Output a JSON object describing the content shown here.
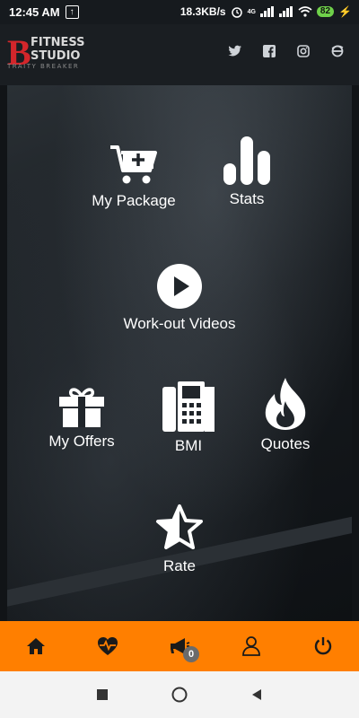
{
  "status_bar": {
    "time": "12:45 AM",
    "net_speed": "18.3KB/s",
    "battery": "82",
    "network": "4G"
  },
  "brand": {
    "logo_letter": "B",
    "line1": "FITNESS",
    "line2": "STUDIO",
    "tagline": "TRAITY BREAKER"
  },
  "social": [
    "twitter-icon",
    "facebook-icon",
    "instagram-icon",
    "web-icon"
  ],
  "menu": {
    "my_package": "My Package",
    "stats": "Stats",
    "workout_videos": "Work-out Videos",
    "my_offers": "My Offers",
    "bmi": "BMI",
    "quotes": "Quotes",
    "rate": "Rate"
  },
  "bottom_nav": {
    "notification_count": "0"
  },
  "colors": {
    "accent": "#ff7f00",
    "brand_red": "#d3262b",
    "badge": "#6b6b6b"
  }
}
